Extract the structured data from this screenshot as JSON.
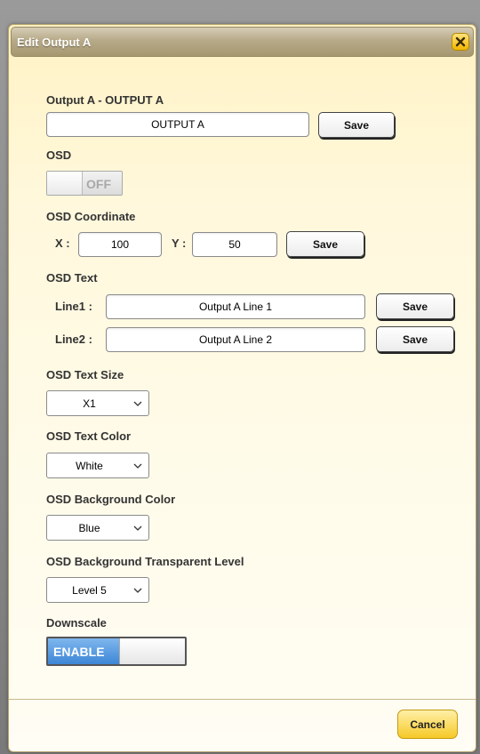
{
  "dialog": {
    "title": "Edit Output A"
  },
  "output_name": {
    "label": "Output A - OUTPUT A",
    "value": "OUTPUT A",
    "save_label": "Save"
  },
  "osd": {
    "label": "OSD",
    "toggle_state": "OFF"
  },
  "osd_coordinate": {
    "label": "OSD Coordinate",
    "x_label": "X :",
    "x_value": "100",
    "y_label": "Y :",
    "y_value": "50",
    "save_label": "Save"
  },
  "osd_text": {
    "label": "OSD Text",
    "line1_label": "Line1 :",
    "line1_value": "Output A Line 1",
    "line1_save_label": "Save",
    "line2_label": "Line2 :",
    "line2_value": "Output A Line 2",
    "line2_save_label": "Save"
  },
  "osd_text_size": {
    "label": "OSD Text Size",
    "selected": "X1"
  },
  "osd_text_color": {
    "label": "OSD Text Color",
    "selected": "White"
  },
  "osd_background_color": {
    "label": "OSD Background Color",
    "selected": "Blue"
  },
  "osd_background_transparent_level": {
    "label": "OSD Background Transparent Level",
    "selected": "Level 5"
  },
  "downscale": {
    "label": "Downscale",
    "toggle_state": "ENABLE"
  },
  "footer": {
    "cancel_label": "Cancel"
  },
  "colors": {
    "dialog_background": "#fff8dc",
    "titlebar": "#b7aa89",
    "close_button": "#f1b600",
    "toggle_enabled": "#3d86d6",
    "cancel_button": "#f6c928"
  },
  "icons": {
    "close": "close-icon",
    "select_arrow": "chevron-down-icon"
  }
}
